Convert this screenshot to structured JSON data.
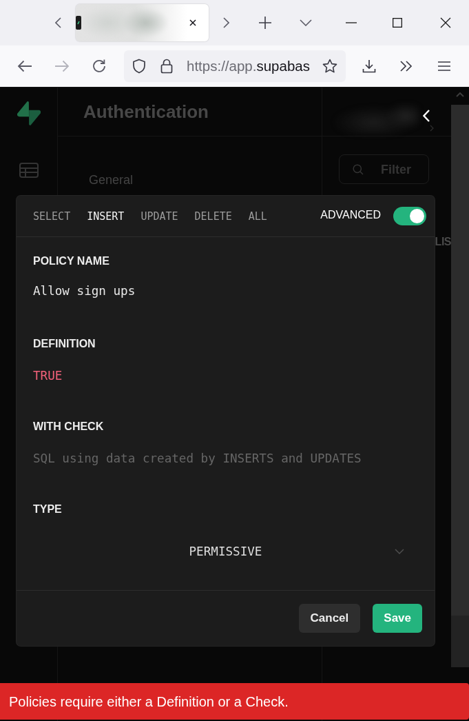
{
  "browser": {
    "address_bar": {
      "url_prefix": "https://app.",
      "url_host": "supabas"
    }
  },
  "page": {
    "title": "Authentication",
    "menu_section": "General",
    "filter": {
      "placeholder": "Filter"
    },
    "column_text": "LIS"
  },
  "modal": {
    "tabs": [
      {
        "label": "SELECT",
        "selected": false
      },
      {
        "label": "INSERT",
        "selected": true
      },
      {
        "label": "UPDATE",
        "selected": false
      },
      {
        "label": "DELETE",
        "selected": false
      },
      {
        "label": "ALL",
        "selected": false
      }
    ],
    "advanced": {
      "label": "ADVANCED",
      "on": true
    },
    "fields": [
      {
        "kind": "text",
        "label": "POLICY NAME",
        "value": "Allow sign ups"
      },
      {
        "kind": "code",
        "label": "DEFINITION",
        "value": "TRUE"
      },
      {
        "kind": "code",
        "label": "WITH CHECK",
        "placeholder": "SQL using data created by INSERTS and UPDATES"
      },
      {
        "kind": "select",
        "label": "TYPE",
        "value": "PERMISSIVE"
      }
    ],
    "buttons": [
      {
        "kind": "secondary",
        "label": "Cancel"
      },
      {
        "kind": "primary",
        "label": "Save"
      }
    ]
  },
  "toast": {
    "kind": "error",
    "message": "Policies require either a Definition or a Check."
  }
}
